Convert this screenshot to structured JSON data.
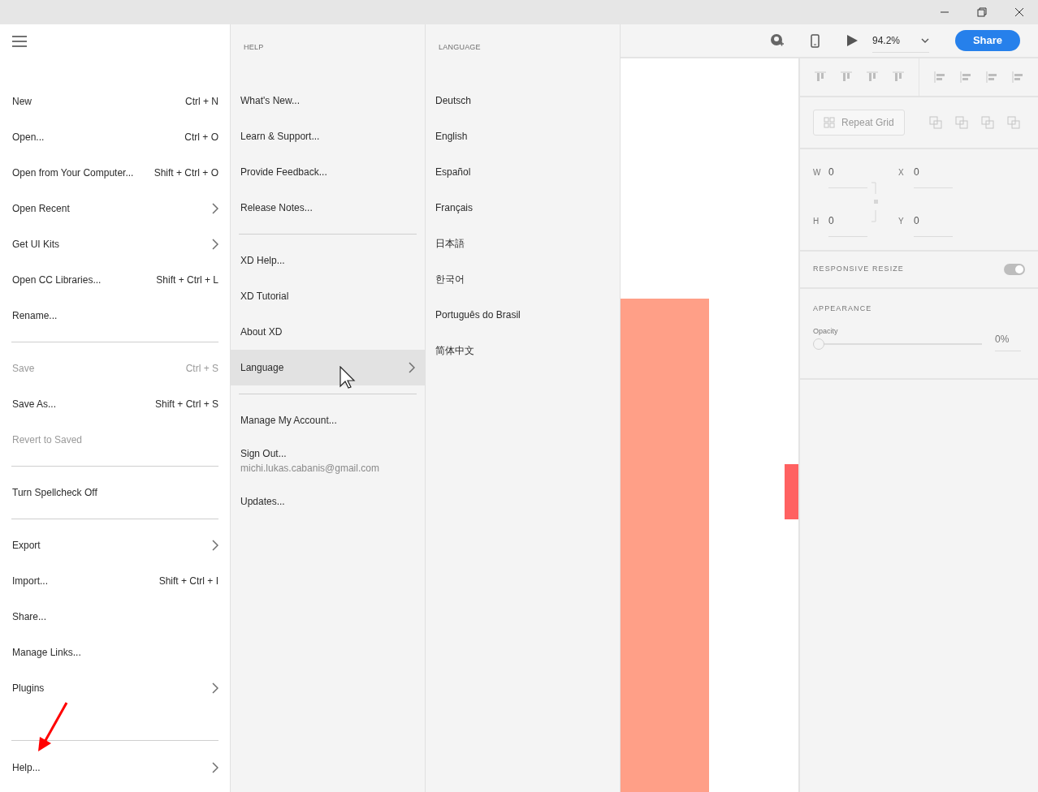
{
  "main_menu": {
    "items": [
      {
        "kind": "item",
        "label": "New",
        "shortcut": "Ctrl + N",
        "submenu": false,
        "disabled": false
      },
      {
        "kind": "item",
        "label": "Open...",
        "shortcut": "Ctrl + O",
        "submenu": false,
        "disabled": false
      },
      {
        "kind": "item",
        "label": "Open from Your Computer...",
        "shortcut": "Shift + Ctrl + O",
        "submenu": false,
        "disabled": false
      },
      {
        "kind": "item",
        "label": "Open Recent",
        "submenu": true,
        "disabled": false
      },
      {
        "kind": "item",
        "label": "Get UI Kits",
        "submenu": true,
        "disabled": false
      },
      {
        "kind": "item",
        "label": "Open CC Libraries...",
        "shortcut": "Shift + Ctrl + L",
        "submenu": false,
        "disabled": false
      },
      {
        "kind": "item",
        "label": "Rename...",
        "submenu": false,
        "disabled": false
      },
      {
        "kind": "separator"
      },
      {
        "kind": "item",
        "label": "Save",
        "shortcut": "Ctrl + S",
        "submenu": false,
        "disabled": true
      },
      {
        "kind": "item",
        "label": "Save As...",
        "shortcut": "Shift + Ctrl + S",
        "submenu": false,
        "disabled": false
      },
      {
        "kind": "item",
        "label": "Revert to Saved",
        "submenu": false,
        "disabled": true
      },
      {
        "kind": "separator"
      },
      {
        "kind": "item",
        "label": "Turn Spellcheck Off",
        "submenu": false,
        "disabled": false
      },
      {
        "kind": "separator"
      },
      {
        "kind": "item",
        "label": "Export",
        "submenu": true,
        "disabled": false
      },
      {
        "kind": "item",
        "label": "Import...",
        "shortcut": "Shift + Ctrl + I",
        "submenu": false,
        "disabled": false
      },
      {
        "kind": "item",
        "label": "Share...",
        "submenu": false,
        "disabled": false
      },
      {
        "kind": "item",
        "label": "Manage Links...",
        "submenu": false,
        "disabled": false
      },
      {
        "kind": "item",
        "label": "Plugins",
        "submenu": true,
        "disabled": false
      },
      {
        "kind": "separator"
      },
      {
        "kind": "item",
        "label": "Help...",
        "submenu": true,
        "disabled": false
      }
    ]
  },
  "help_menu": {
    "heading": "HELP",
    "items": [
      {
        "kind": "item",
        "label": "What's New...",
        "selected": false,
        "submenu": false
      },
      {
        "kind": "item",
        "label": "Learn & Support...",
        "selected": false,
        "submenu": false
      },
      {
        "kind": "item",
        "label": "Provide Feedback...",
        "selected": false,
        "submenu": false
      },
      {
        "kind": "item",
        "label": "Release Notes...",
        "selected": false,
        "submenu": false
      },
      {
        "kind": "separator"
      },
      {
        "kind": "item",
        "label": "XD Help...",
        "selected": false,
        "submenu": false
      },
      {
        "kind": "item",
        "label": "XD Tutorial",
        "selected": false,
        "submenu": false
      },
      {
        "kind": "item",
        "label": "About XD",
        "selected": false,
        "submenu": false
      },
      {
        "kind": "item",
        "label": "Language",
        "selected": true,
        "submenu": true
      },
      {
        "kind": "separator"
      },
      {
        "kind": "item",
        "label": "Manage My Account...",
        "selected": false,
        "submenu": false
      },
      {
        "kind": "item",
        "label": "Sign Out...",
        "sublabel": "michi.lukas.cabanis@gmail.com",
        "selected": false,
        "submenu": false
      },
      {
        "kind": "item",
        "label": "Updates...",
        "selected": false,
        "submenu": false
      }
    ]
  },
  "language_menu": {
    "heading": "LANGUAGE",
    "items": [
      "Deutsch",
      "English",
      "Español",
      "Français",
      "日本語",
      "한국어",
      "Português do Brasil",
      "简体中文"
    ]
  },
  "toolbar": {
    "zoom": "94.2%",
    "share": "Share"
  },
  "properties": {
    "repeat_grid": "Repeat Grid",
    "fields": [
      {
        "label": "W",
        "value": "0"
      },
      {
        "label": "X",
        "value": "0"
      },
      {
        "label": "H",
        "value": "0"
      },
      {
        "label": "Y",
        "value": "0"
      }
    ],
    "responsive_resize": {
      "label": "RESPONSIVE RESIZE",
      "on": true
    },
    "appearance": {
      "heading": "APPEARANCE",
      "opacity_label": "Opacity",
      "level": 0,
      "reading": "0%"
    }
  }
}
